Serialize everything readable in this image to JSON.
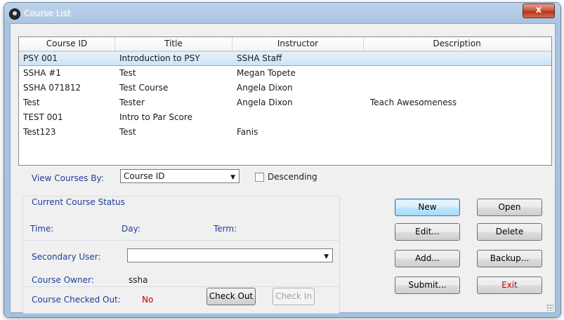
{
  "window": {
    "title": "Course List",
    "close_glyph": "x"
  },
  "table": {
    "columns": [
      "Course ID",
      "Title",
      "Instructor",
      "Description"
    ],
    "rows": [
      [
        "PSY 001",
        "Introduction to PSY",
        "SSHA Staff",
        ""
      ],
      [
        "SSHA #1",
        "Test",
        "Megan Topete",
        ""
      ],
      [
        "SSHA 071812",
        "Test Course",
        "Angela Dixon",
        ""
      ],
      [
        "Test",
        "Tester",
        "Angela Dixon",
        "Teach Awesomeness"
      ],
      [
        "TEST 001",
        "Intro to Par Score",
        "",
        ""
      ],
      [
        "Test123",
        "Test",
        "Fanis",
        ""
      ]
    ],
    "selected_row_index": 0
  },
  "view_by": {
    "label": "View Courses By:",
    "value": "Course ID",
    "descending_label": "Descending",
    "descending_checked": false
  },
  "status": {
    "heading": "Current Course Status",
    "time_label": "Time:",
    "day_label": "Day:",
    "term_label": "Term:",
    "secondary_user_label": "Secondary User:",
    "secondary_user_value": "",
    "course_owner_label": "Course Owner:",
    "course_owner_value": "ssha",
    "checked_out_label": "Course Checked Out:",
    "checked_out_value": "No",
    "check_out_button": "Check Out",
    "check_in_button": "Check In"
  },
  "buttons": {
    "new": "New",
    "open": "Open",
    "edit": "Edit...",
    "delete": "Delete",
    "add": "Add...",
    "backup": "Backup...",
    "submit": "Submit...",
    "exit": "Exit"
  },
  "colors": {
    "label_blue": "#1f3d99",
    "exit_red": "#c00000",
    "no_red": "#c00000",
    "selection": "#cde4f7"
  }
}
